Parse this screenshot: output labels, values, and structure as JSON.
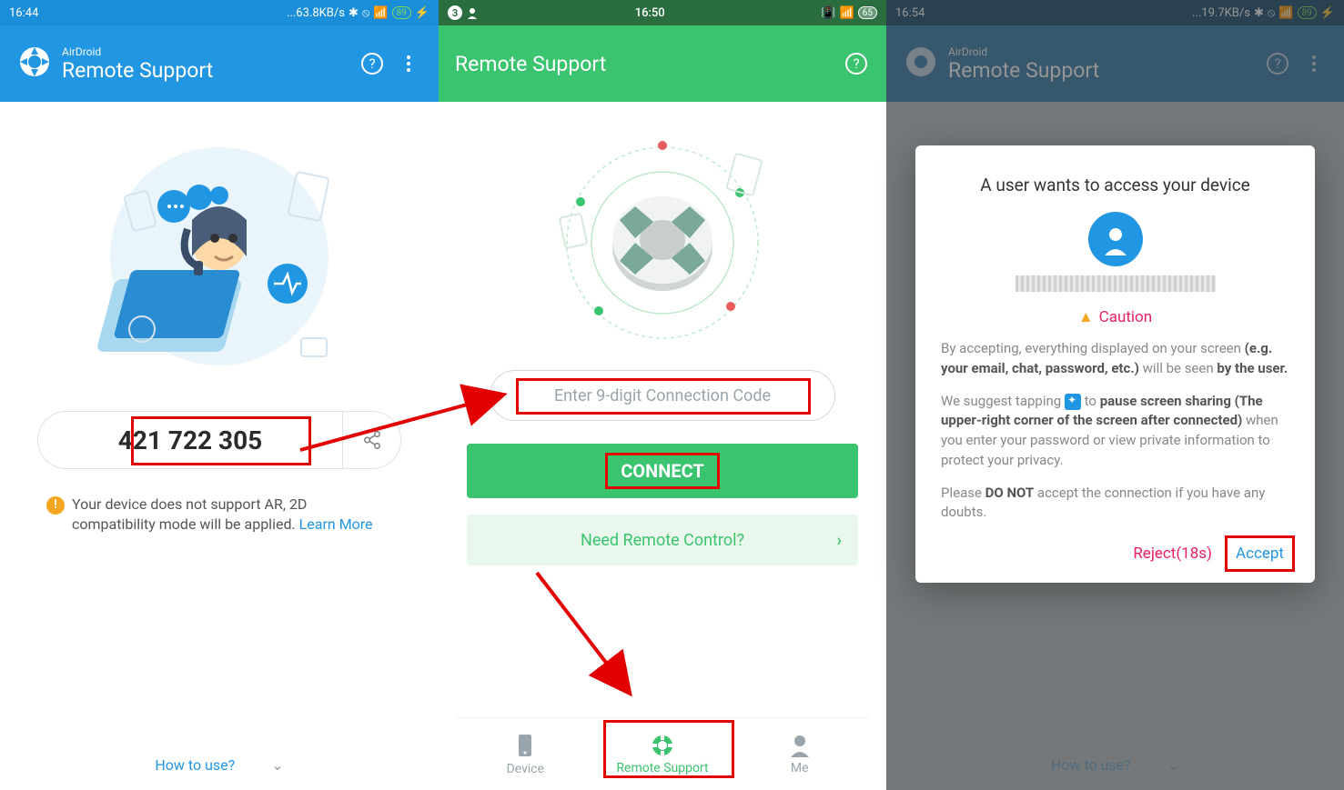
{
  "screen1": {
    "statusbar": {
      "time": "16:44",
      "net": "...63.8KB/s",
      "battery": "89"
    },
    "appbar": {
      "sub": "AirDroid",
      "title": "Remote Support"
    },
    "code": "421 722 305",
    "warning_text": "Your device does not support AR, 2D compatibility mode will be applied. ",
    "learn_more": "Learn More",
    "howto": "How to use?"
  },
  "screen2": {
    "statusbar": {
      "badge": "3",
      "time": "16:50",
      "battery": "65"
    },
    "appbar": {
      "title": "Remote Support"
    },
    "input_placeholder": "Enter 9-digit Connection Code",
    "connect": "CONNECT",
    "need_remote": "Need Remote Control?",
    "tabs": {
      "device": "Device",
      "remote": "Remote Support",
      "me": "Me"
    }
  },
  "screen3": {
    "statusbar": {
      "time": "16:54",
      "net": "...19.7KB/s",
      "battery": "89"
    },
    "appbar": {
      "sub": "AirDroid",
      "title": "Remote Support"
    },
    "howto": "How to use?",
    "dialog": {
      "title": "A user wants to access your device",
      "caution": "Caution",
      "p1_a": "By accepting, everything displayed on your screen ",
      "p1_b": "(e.g. your email, chat, password, etc.)",
      "p1_c": " will be seen ",
      "p1_d": "by the user.",
      "p2_a": "We suggest tapping ",
      "p2_b": " to ",
      "p2_c": "pause screen sharing (The upper-right corner of the screen after connected)",
      "p2_d": " when you enter your password or view private information to protect your privacy.",
      "p3_a": "Please ",
      "p3_b": "DO NOT",
      "p3_c": " accept the connection if you have any doubts.",
      "reject": "Reject(18s)",
      "accept": "Accept"
    }
  }
}
